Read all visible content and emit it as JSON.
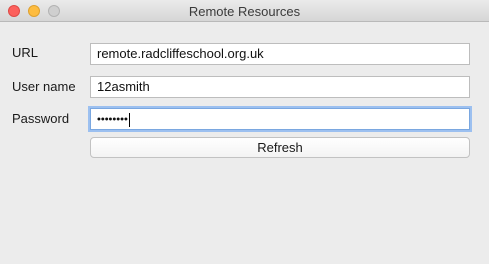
{
  "window": {
    "title": "Remote Resources",
    "controls": [
      "close",
      "minimize",
      "zoom"
    ]
  },
  "form": {
    "url_label": "URL",
    "url_value": "remote.radcliffeschool.org.uk",
    "username_label": "User name",
    "username_value": "12asmith",
    "password_label": "Password",
    "password_masked": "••••••••"
  },
  "actions": {
    "refresh_label": "Refresh"
  },
  "colors": {
    "focus_ring": "#9cc0f0",
    "close": "#fc605c",
    "minimize": "#fdbc40"
  }
}
